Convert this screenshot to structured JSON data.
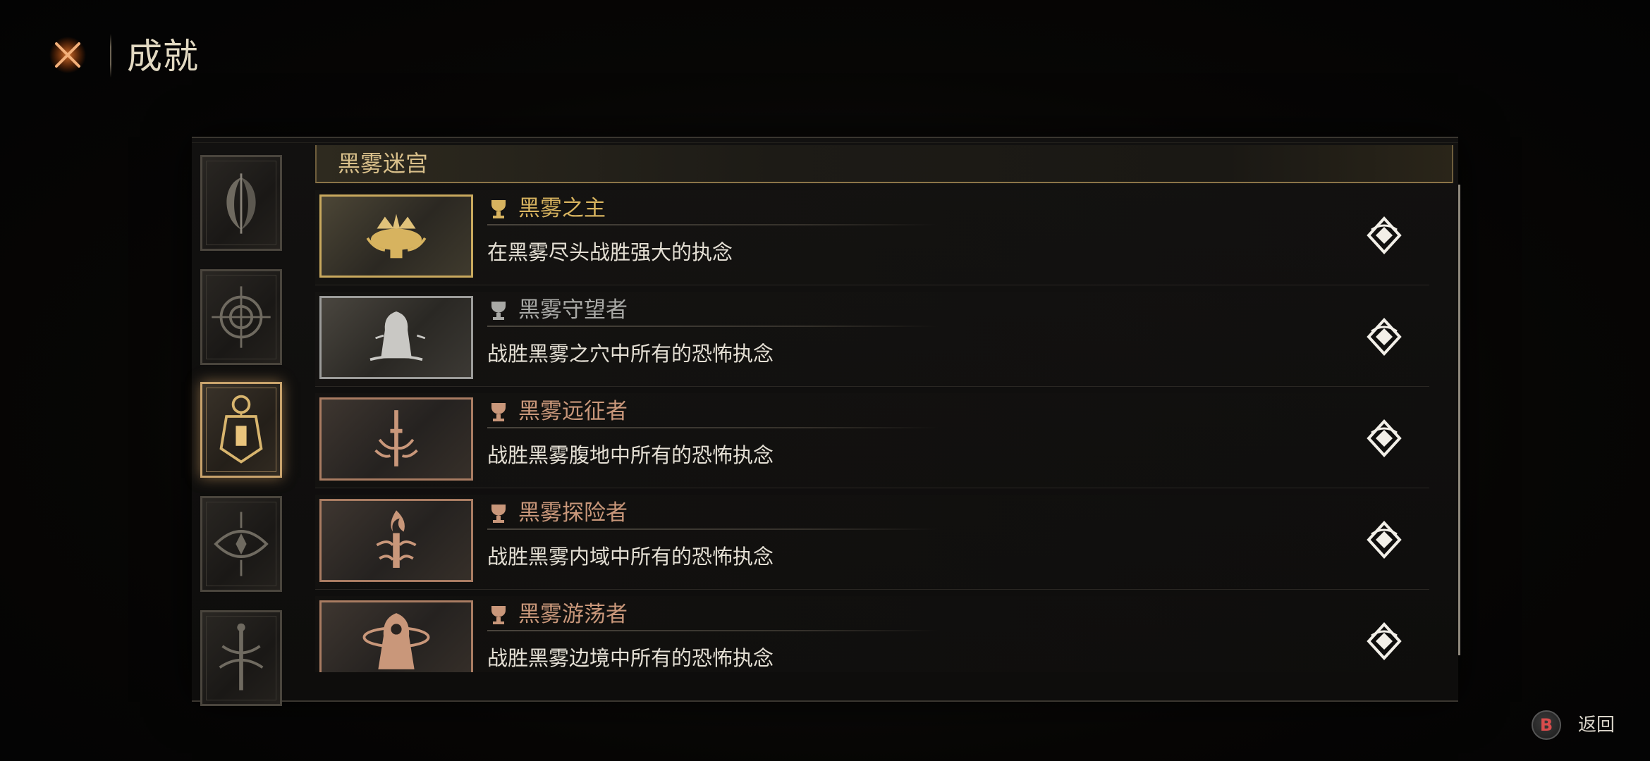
{
  "header": {
    "title": "成就",
    "close_icon": "close-x-icon"
  },
  "sidebar": {
    "categories": [
      {
        "icon": "crescent-blade-icon",
        "active": false
      },
      {
        "icon": "spiral-compass-icon",
        "active": false
      },
      {
        "icon": "lantern-icon",
        "active": true
      },
      {
        "icon": "eye-sigil-icon",
        "active": false
      },
      {
        "icon": "sword-emblem-icon",
        "active": false
      }
    ]
  },
  "section": {
    "title": "黑雾迷宫"
  },
  "achievements": [
    {
      "title": "黑雾之主",
      "description": "在黑雾尽头战胜强大的执念",
      "tier": "gold",
      "tier_color": "#d7b35f",
      "icon": "crown-emblem-icon"
    },
    {
      "title": "黑雾守望者",
      "description": "战胜黑雾之穴中所有的恐怖执念",
      "tier": "silver",
      "tier_color": "#a9a9a6",
      "icon": "hooded-figure-icon"
    },
    {
      "title": "黑雾远征者",
      "description": "战胜黑雾腹地中所有的恐怖执念",
      "tier": "bronze",
      "tier_color": "#c9977a",
      "icon": "sword-flame-icon"
    },
    {
      "title": "黑雾探险者",
      "description": "战胜黑雾内域中所有的恐怖执念",
      "tier": "bronze",
      "tier_color": "#c9977a",
      "icon": "torch-flame-icon"
    },
    {
      "title": "黑雾游荡者",
      "description": "战胜黑雾边境中所有的恐怖执念",
      "tier": "bronze",
      "tier_color": "#c9977a",
      "icon": "hooded-wanderer-icon"
    }
  ],
  "footer": {
    "back_button_key": "B",
    "back_label": "返回"
  }
}
